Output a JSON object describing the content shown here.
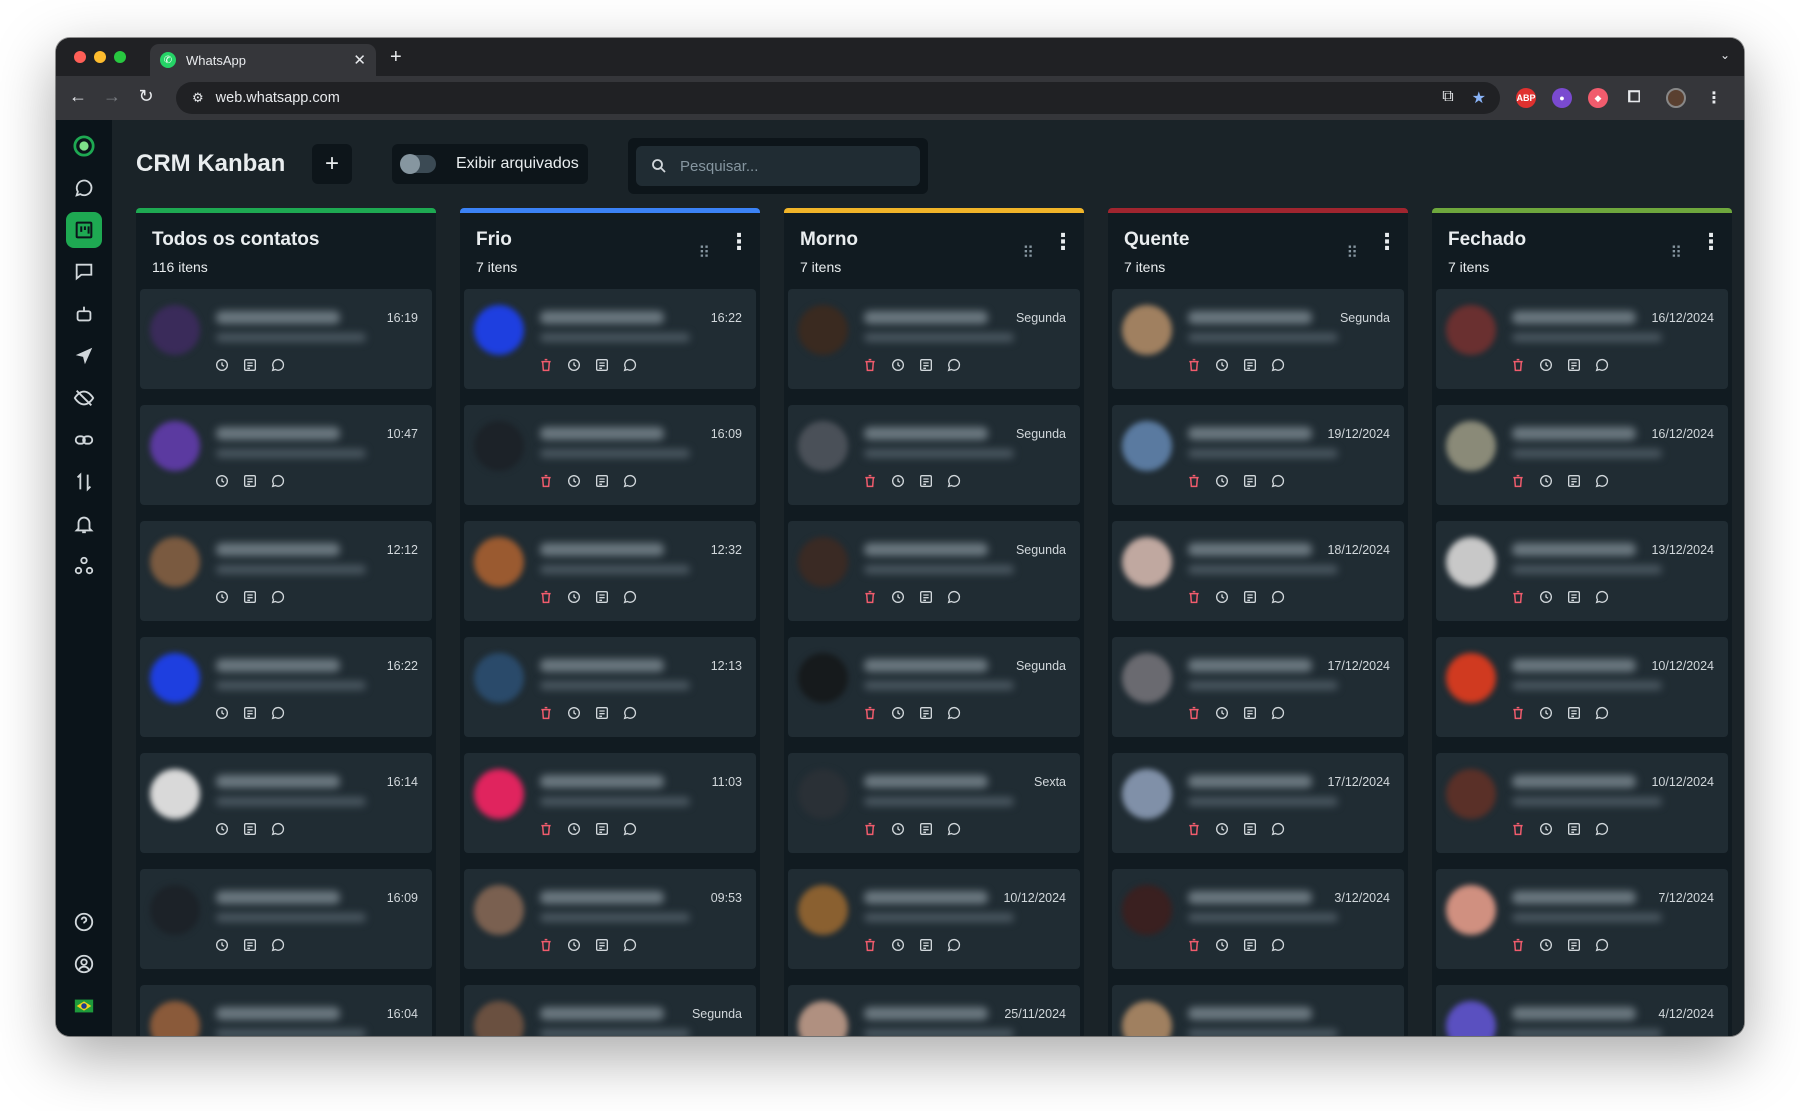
{
  "browser": {
    "tab_title": "WhatsApp",
    "url": "web.whatsapp.com"
  },
  "toolbar": {
    "title": "CRM Kanban",
    "add_label": "+",
    "archived_label": "Exibir arquivados",
    "search_placeholder": "Pesquisar..."
  },
  "colors": {
    "all": "#1ea952",
    "frio": "#3b82f6",
    "morno": "#f0b429",
    "quente": "#a0252f",
    "fechado": "#6ea73d",
    "trash": "#f15c6d"
  },
  "columns": [
    {
      "title": "Todos os contatos",
      "count": "116 itens",
      "color": "#1ea952",
      "has_menu": false,
      "cards": [
        {
          "time": "16:19",
          "avatar": "#3a2b5a",
          "trash": false
        },
        {
          "time": "10:47",
          "avatar": "#5b3aa0",
          "trash": false
        },
        {
          "time": "12:12",
          "avatar": "#7a5a40",
          "trash": false
        },
        {
          "time": "16:22",
          "avatar": "#1e3fe0",
          "trash": false
        },
        {
          "time": "16:14",
          "avatar": "#d9d9d9",
          "trash": false
        },
        {
          "time": "16:09",
          "avatar": "#1c2228",
          "trash": false
        },
        {
          "time": "16:04",
          "avatar": "#8a5a3a",
          "trash": false
        }
      ]
    },
    {
      "title": "Frio",
      "count": "7 itens",
      "color": "#3b82f6",
      "has_menu": true,
      "cards": [
        {
          "time": "16:22",
          "avatar": "#1e3fe0",
          "trash": true
        },
        {
          "time": "16:09",
          "avatar": "#1c2228",
          "trash": true
        },
        {
          "time": "12:32",
          "avatar": "#9a5a30",
          "trash": true
        },
        {
          "time": "12:13",
          "avatar": "#2a4a6a",
          "trash": true
        },
        {
          "time": "11:03",
          "avatar": "#e0245e",
          "trash": true
        },
        {
          "time": "09:53",
          "avatar": "#7a6050",
          "trash": true
        },
        {
          "time": "Segunda",
          "avatar": "#6a5040",
          "trash": true
        }
      ]
    },
    {
      "title": "Morno",
      "count": "7 itens",
      "color": "#f0b429",
      "has_menu": true,
      "cards": [
        {
          "time": "Segunda",
          "avatar": "#3a2a20",
          "trash": true
        },
        {
          "time": "Segunda",
          "avatar": "#4a5058",
          "trash": true
        },
        {
          "time": "Segunda",
          "avatar": "#3a2a24",
          "trash": true
        },
        {
          "time": "Segunda",
          "avatar": "#161a1c",
          "trash": true
        },
        {
          "time": "Sexta",
          "avatar": "#2a3036",
          "trash": true
        },
        {
          "time": "10/12/2024",
          "avatar": "#8a6030",
          "trash": true
        },
        {
          "time": "25/11/2024",
          "avatar": "#b09080",
          "trash": true
        }
      ]
    },
    {
      "title": "Quente",
      "count": "7 itens",
      "color": "#a0252f",
      "has_menu": true,
      "cards": [
        {
          "time": "Segunda",
          "avatar": "#a08060",
          "trash": true
        },
        {
          "time": "19/12/2024",
          "avatar": "#5a7aa0",
          "trash": true
        },
        {
          "time": "18/12/2024",
          "avatar": "#c0a8a0",
          "trash": true
        },
        {
          "time": "17/12/2024",
          "avatar": "#6a6a70",
          "trash": true
        },
        {
          "time": "17/12/2024",
          "avatar": "#8090a8",
          "trash": true
        },
        {
          "time": "3/12/2024",
          "avatar": "#3a2020",
          "trash": true
        },
        {
          "time": "",
          "avatar": "#a08060",
          "trash": true
        }
      ]
    },
    {
      "title": "Fechado",
      "count": "7 itens",
      "color": "#6ea73d",
      "has_menu": true,
      "cards": [
        {
          "time": "16/12/2024",
          "avatar": "#6a3030",
          "trash": true
        },
        {
          "time": "16/12/2024",
          "avatar": "#8a8a78",
          "trash": true
        },
        {
          "time": "13/12/2024",
          "avatar": "#c8c8c8",
          "trash": true
        },
        {
          "time": "10/12/2024",
          "avatar": "#d03a20",
          "trash": true
        },
        {
          "time": "10/12/2024",
          "avatar": "#5a3028",
          "trash": true
        },
        {
          "time": "7/12/2024",
          "avatar": "#d09080",
          "trash": true
        },
        {
          "time": "4/12/2024",
          "avatar": "#5a50c0",
          "trash": true
        }
      ]
    }
  ],
  "sidebar": {
    "icons": [
      "logo-icon",
      "whatsapp-icon",
      "kanban-icon",
      "chat-icon",
      "bot-icon",
      "send-icon",
      "eye-off-icon",
      "link-icon",
      "transfer-icon",
      "bell-icon",
      "webhook-icon"
    ],
    "bottom_icons": [
      "help-icon",
      "user-icon",
      "brazil-flag-icon"
    ]
  }
}
